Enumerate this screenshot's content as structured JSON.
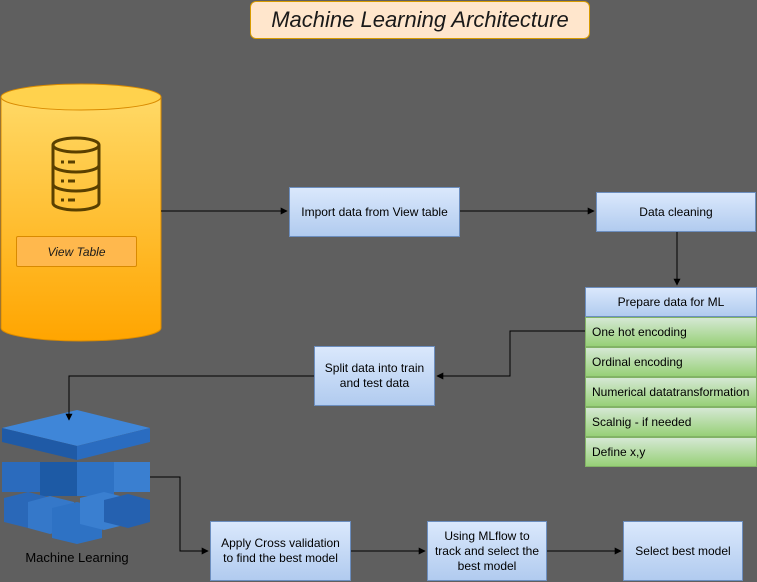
{
  "title": "Machine Learning Architecture",
  "database": {
    "label": "View Table",
    "icon": "database-icon"
  },
  "nodes": {
    "import": "Import data from View table",
    "cleaning": "Data cleaning",
    "split": "Split data into train and test data",
    "cross_validation": "Apply Cross validation to find the best model",
    "mlflow": "Using MLflow to track and select the best model",
    "select": "Select best model"
  },
  "prepare": {
    "header": "Prepare data for ML",
    "items": [
      "One hot encoding",
      "Ordinal encoding",
      "Numerical datatransformation",
      "Scalnig - if needed",
      "Define x,y"
    ]
  },
  "ml_block": {
    "label": "Machine Learning",
    "icon": "machine-learning-blocks-icon"
  },
  "colors": {
    "background": "#5f5f5f",
    "process_fill": "#dae8fc",
    "process_stroke": "#6c8ebf",
    "list_fill": "#97d077",
    "cylinder": "#ffb31a",
    "ml_blue": "#2e72c4"
  }
}
